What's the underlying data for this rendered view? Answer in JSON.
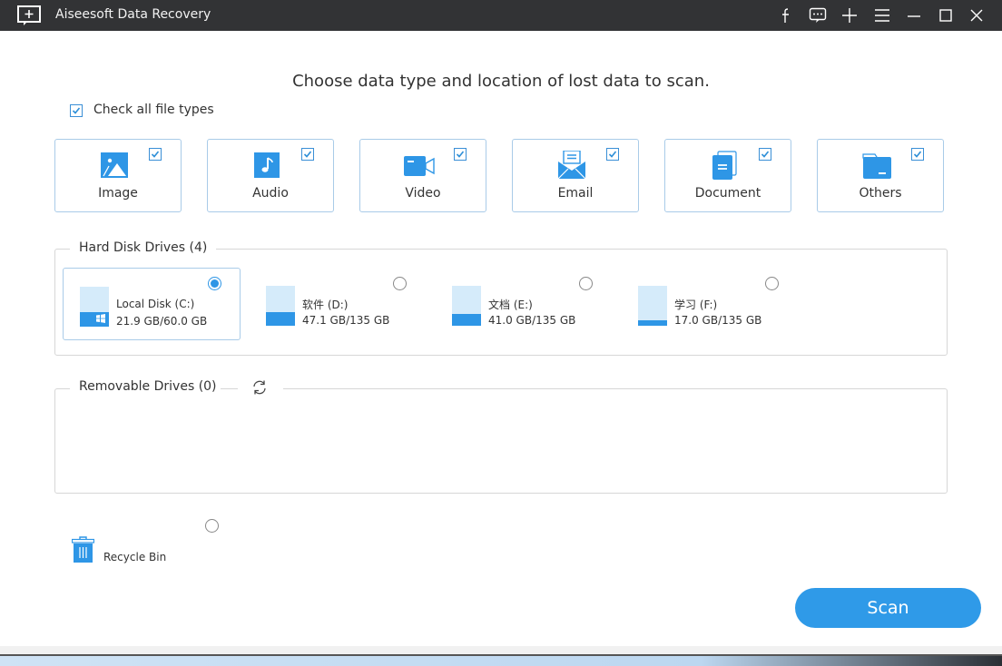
{
  "window": {
    "title": "Aiseesoft Data Recovery",
    "controls": [
      {
        "name": "facebook-icon",
        "glyph": "f"
      },
      {
        "name": "feedback-icon",
        "glyph": "chat"
      },
      {
        "name": "register-icon",
        "glyph": "+"
      },
      {
        "name": "menu-icon",
        "glyph": "menu"
      },
      {
        "name": "minimize-icon",
        "glyph": "min"
      },
      {
        "name": "maximize-icon",
        "glyph": "max"
      },
      {
        "name": "close-icon",
        "glyph": "x"
      }
    ]
  },
  "heading": "Choose data type and location of lost data to scan.",
  "check_all": {
    "label": "Check all file types",
    "checked": true
  },
  "file_types": [
    {
      "label": "Image",
      "icon": "image-icon",
      "checked": true
    },
    {
      "label": "Audio",
      "icon": "audio-icon",
      "checked": true
    },
    {
      "label": "Video",
      "icon": "video-icon",
      "checked": true
    },
    {
      "label": "Email",
      "icon": "email-icon",
      "checked": true
    },
    {
      "label": "Document",
      "icon": "document-icon",
      "checked": true
    },
    {
      "label": "Others",
      "icon": "folder-icon",
      "checked": true
    }
  ],
  "hard_disk": {
    "label": "Hard Disk Drives (4)",
    "drives": [
      {
        "name": "Local Disk (C:)",
        "size": "21.9 GB/60.0 GB",
        "used_fraction": 0.365,
        "selected": true,
        "system": true
      },
      {
        "name": "软件 (D:)",
        "size": "47.1 GB/135 GB",
        "used_fraction": 0.349,
        "selected": false,
        "system": false
      },
      {
        "name": "文档 (E:)",
        "size": "41.0 GB/135 GB",
        "used_fraction": 0.304,
        "selected": false,
        "system": false
      },
      {
        "name": "学习 (F:)",
        "size": "17.0 GB/135 GB",
        "used_fraction": 0.126,
        "selected": false,
        "system": false
      }
    ]
  },
  "removable": {
    "label": "Removable Drives (0)"
  },
  "recycle_bin": {
    "label": "Recycle Bin",
    "selected": false
  },
  "scan_button": "Scan",
  "colors": {
    "accent": "#2e96e6",
    "titlebar": "#323335",
    "card_border": "#a9cbe8"
  }
}
